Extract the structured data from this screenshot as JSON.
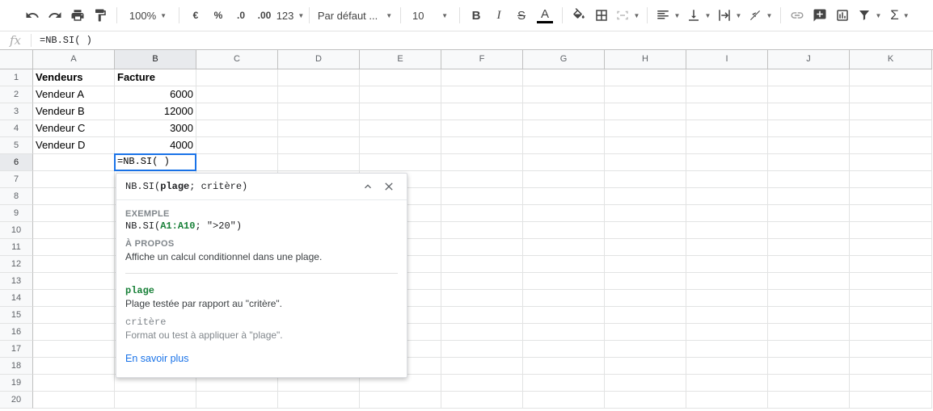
{
  "toolbar": {
    "zoom": "100%",
    "currency": "€",
    "percent": "%",
    "decimal_decrease": ".0",
    "decimal_increase": ".00",
    "more_formats": "123",
    "font": "Par défaut ...",
    "font_size": "10",
    "text_color_hex": "#000000"
  },
  "formula_bar": {
    "fx_label": "fx",
    "value": "=NB.SI( )"
  },
  "columns": [
    "A",
    "B",
    "C",
    "D",
    "E",
    "F",
    "G",
    "H",
    "I",
    "J",
    "K"
  ],
  "rows": [
    "1",
    "2",
    "3",
    "4",
    "5",
    "6",
    "7",
    "8",
    "9",
    "10",
    "11",
    "12",
    "13",
    "14",
    "15",
    "16",
    "17",
    "18",
    "19",
    "20"
  ],
  "cells": {
    "A1": "Vendeurs",
    "B1": "Facture",
    "A2": "Vendeur A",
    "B2": "6000",
    "A3": "Vendeur B",
    "B3": "12000",
    "A4": "Vendeur C",
    "B4": "3000",
    "A5": "Vendeur D",
    "B5": "4000",
    "B6": "=NB.SI( )"
  },
  "active_cell": "B6",
  "popup": {
    "signature_fn": "NB.SI(",
    "signature_arg1": "plage",
    "signature_sep": "; critère)",
    "example_label": "EXEMPLE",
    "example_fn": "NB.SI(",
    "example_range": "A1:A10",
    "example_rest": "; \">20\")",
    "about_label": "À PROPOS",
    "about_text": "Affiche un calcul conditionnel dans une plage.",
    "param1_name": "plage",
    "param1_desc": "Plage testée par rapport au \"critère\".",
    "param2_name": "critère",
    "param2_desc": "Format ou test à appliquer à \"plage\".",
    "learn_more": "En savoir plus"
  },
  "colors": {
    "accent": "#1a73e8",
    "param_green": "#188038"
  }
}
